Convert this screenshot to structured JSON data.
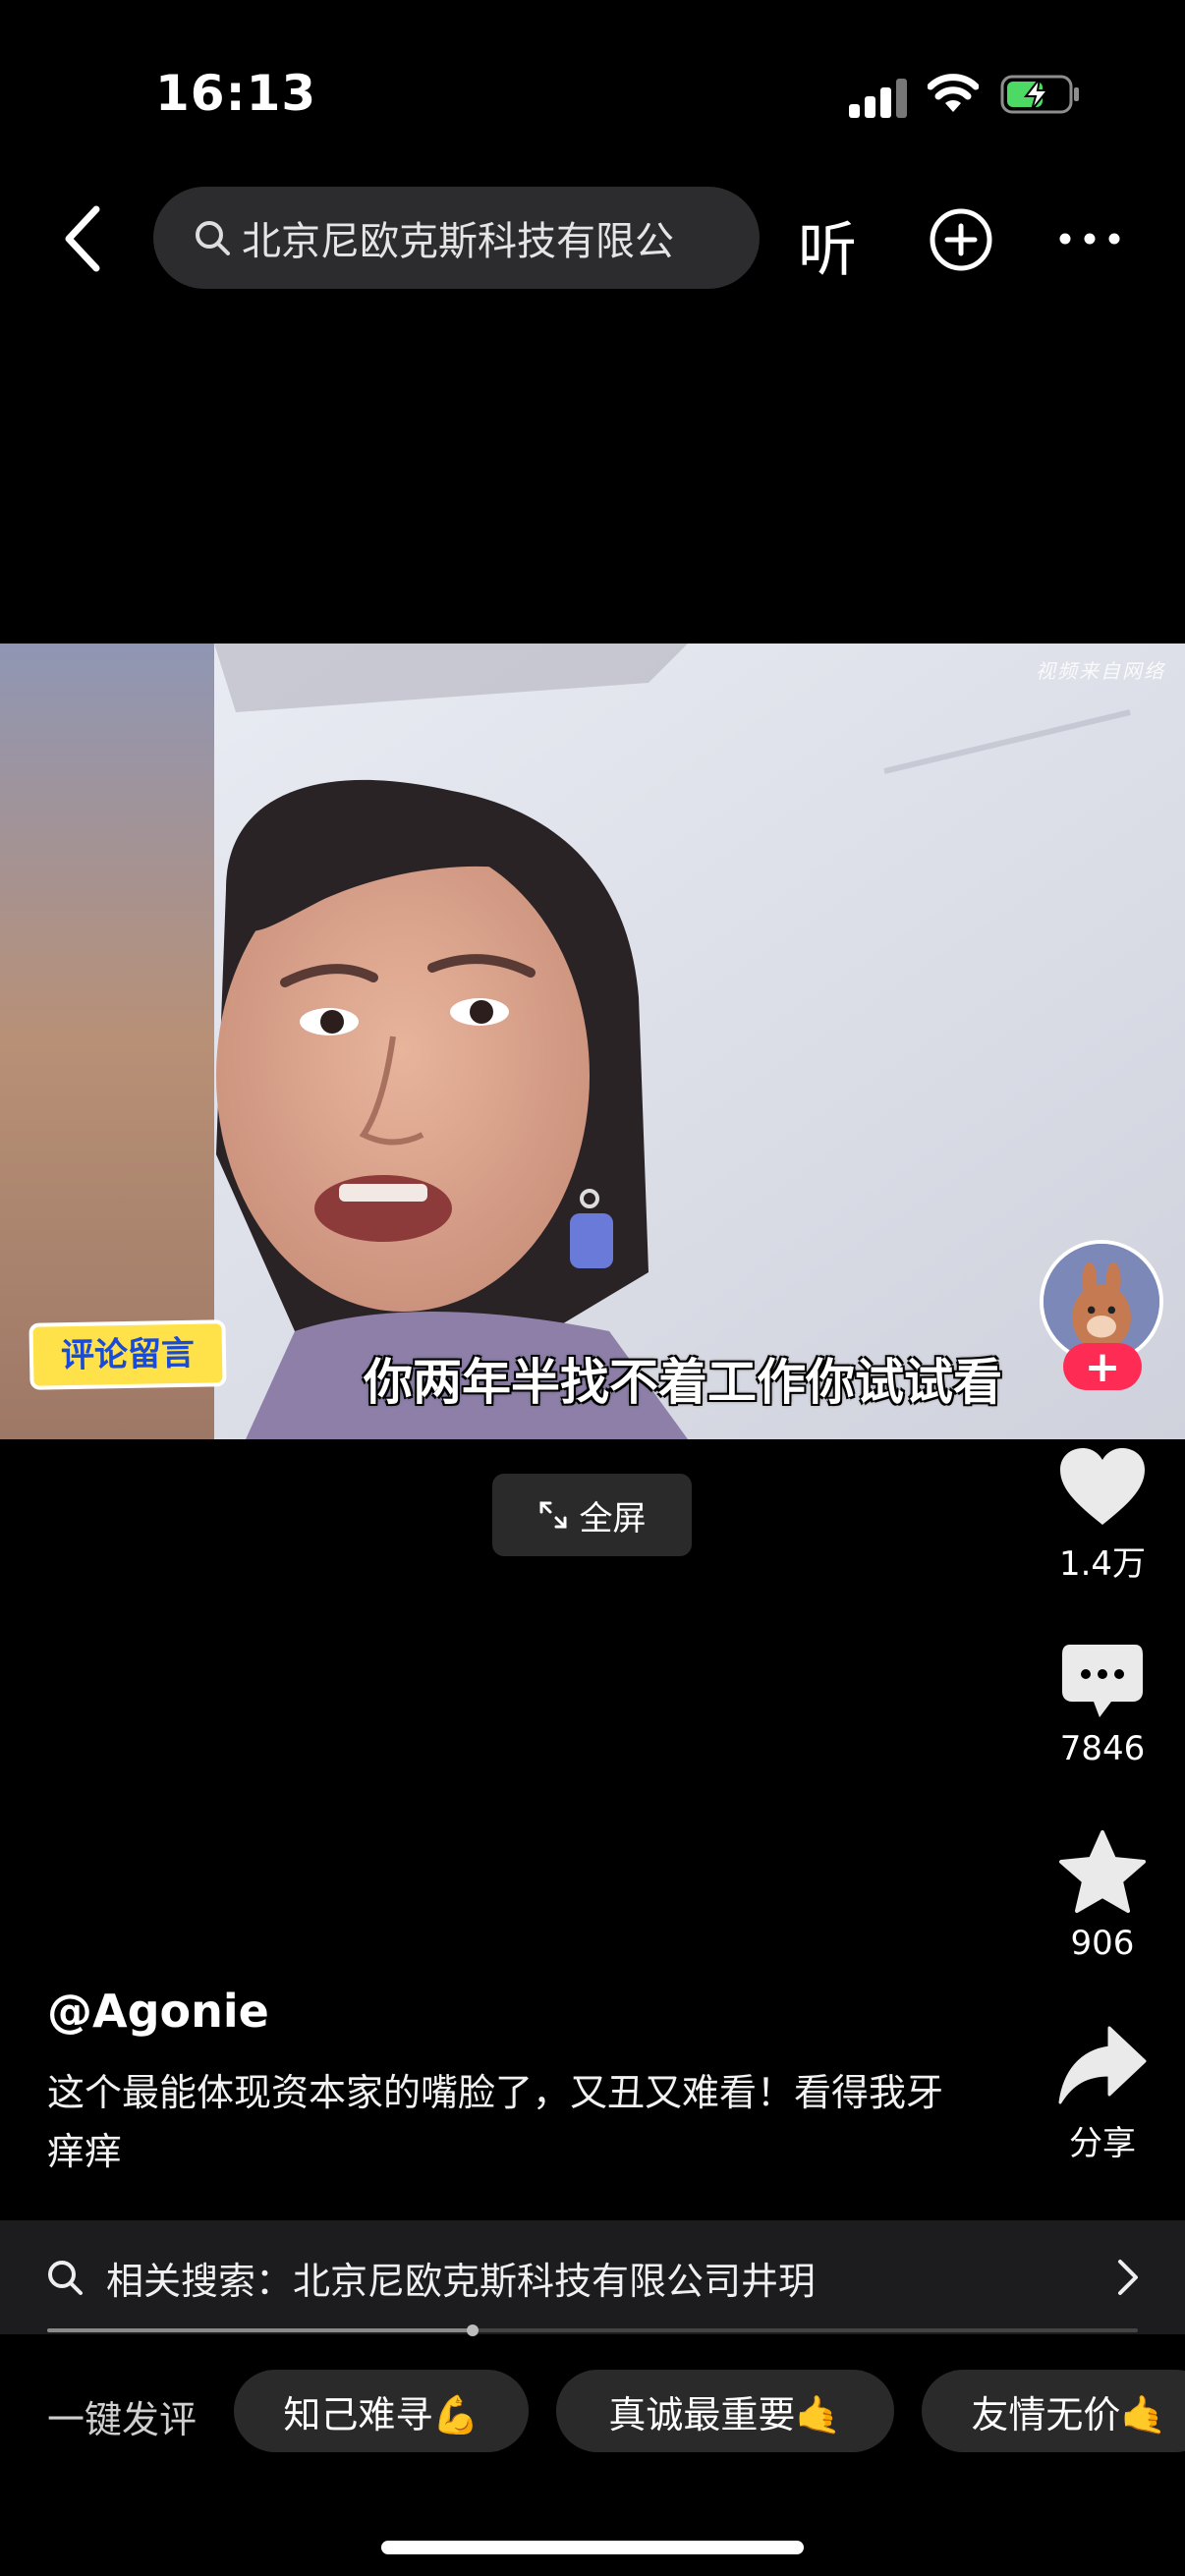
{
  "status_bar": {
    "time": "16:13"
  },
  "nav": {
    "search_text": "北京尼欧克斯科技有限公",
    "listen_label": "听"
  },
  "video": {
    "watermark": "视频来自网络",
    "sticker_text": "评论留言",
    "subtitle": "你两年半找不着工作你试试看"
  },
  "fullscreen": {
    "label": "全屏"
  },
  "actions": {
    "like_count": "1.4万",
    "comment_count": "7846",
    "favorite_count": "906",
    "share_label": "分享"
  },
  "post": {
    "author": "@Agonie",
    "caption": "这个最能体现资本家的嘴脸了，又丑又难看！看得我牙痒痒"
  },
  "related": {
    "text": "相关搜索：北京尼欧克斯科技有限公司井玥"
  },
  "playback": {
    "progress": 0.39
  },
  "quick_comment": {
    "label": "一键发评",
    "chips": [
      "知己难寻💪",
      "真诚最重要🤙",
      "友情无价🤙"
    ]
  },
  "colors": {
    "accent": "#fe2c55",
    "battery": "#4cd964"
  }
}
